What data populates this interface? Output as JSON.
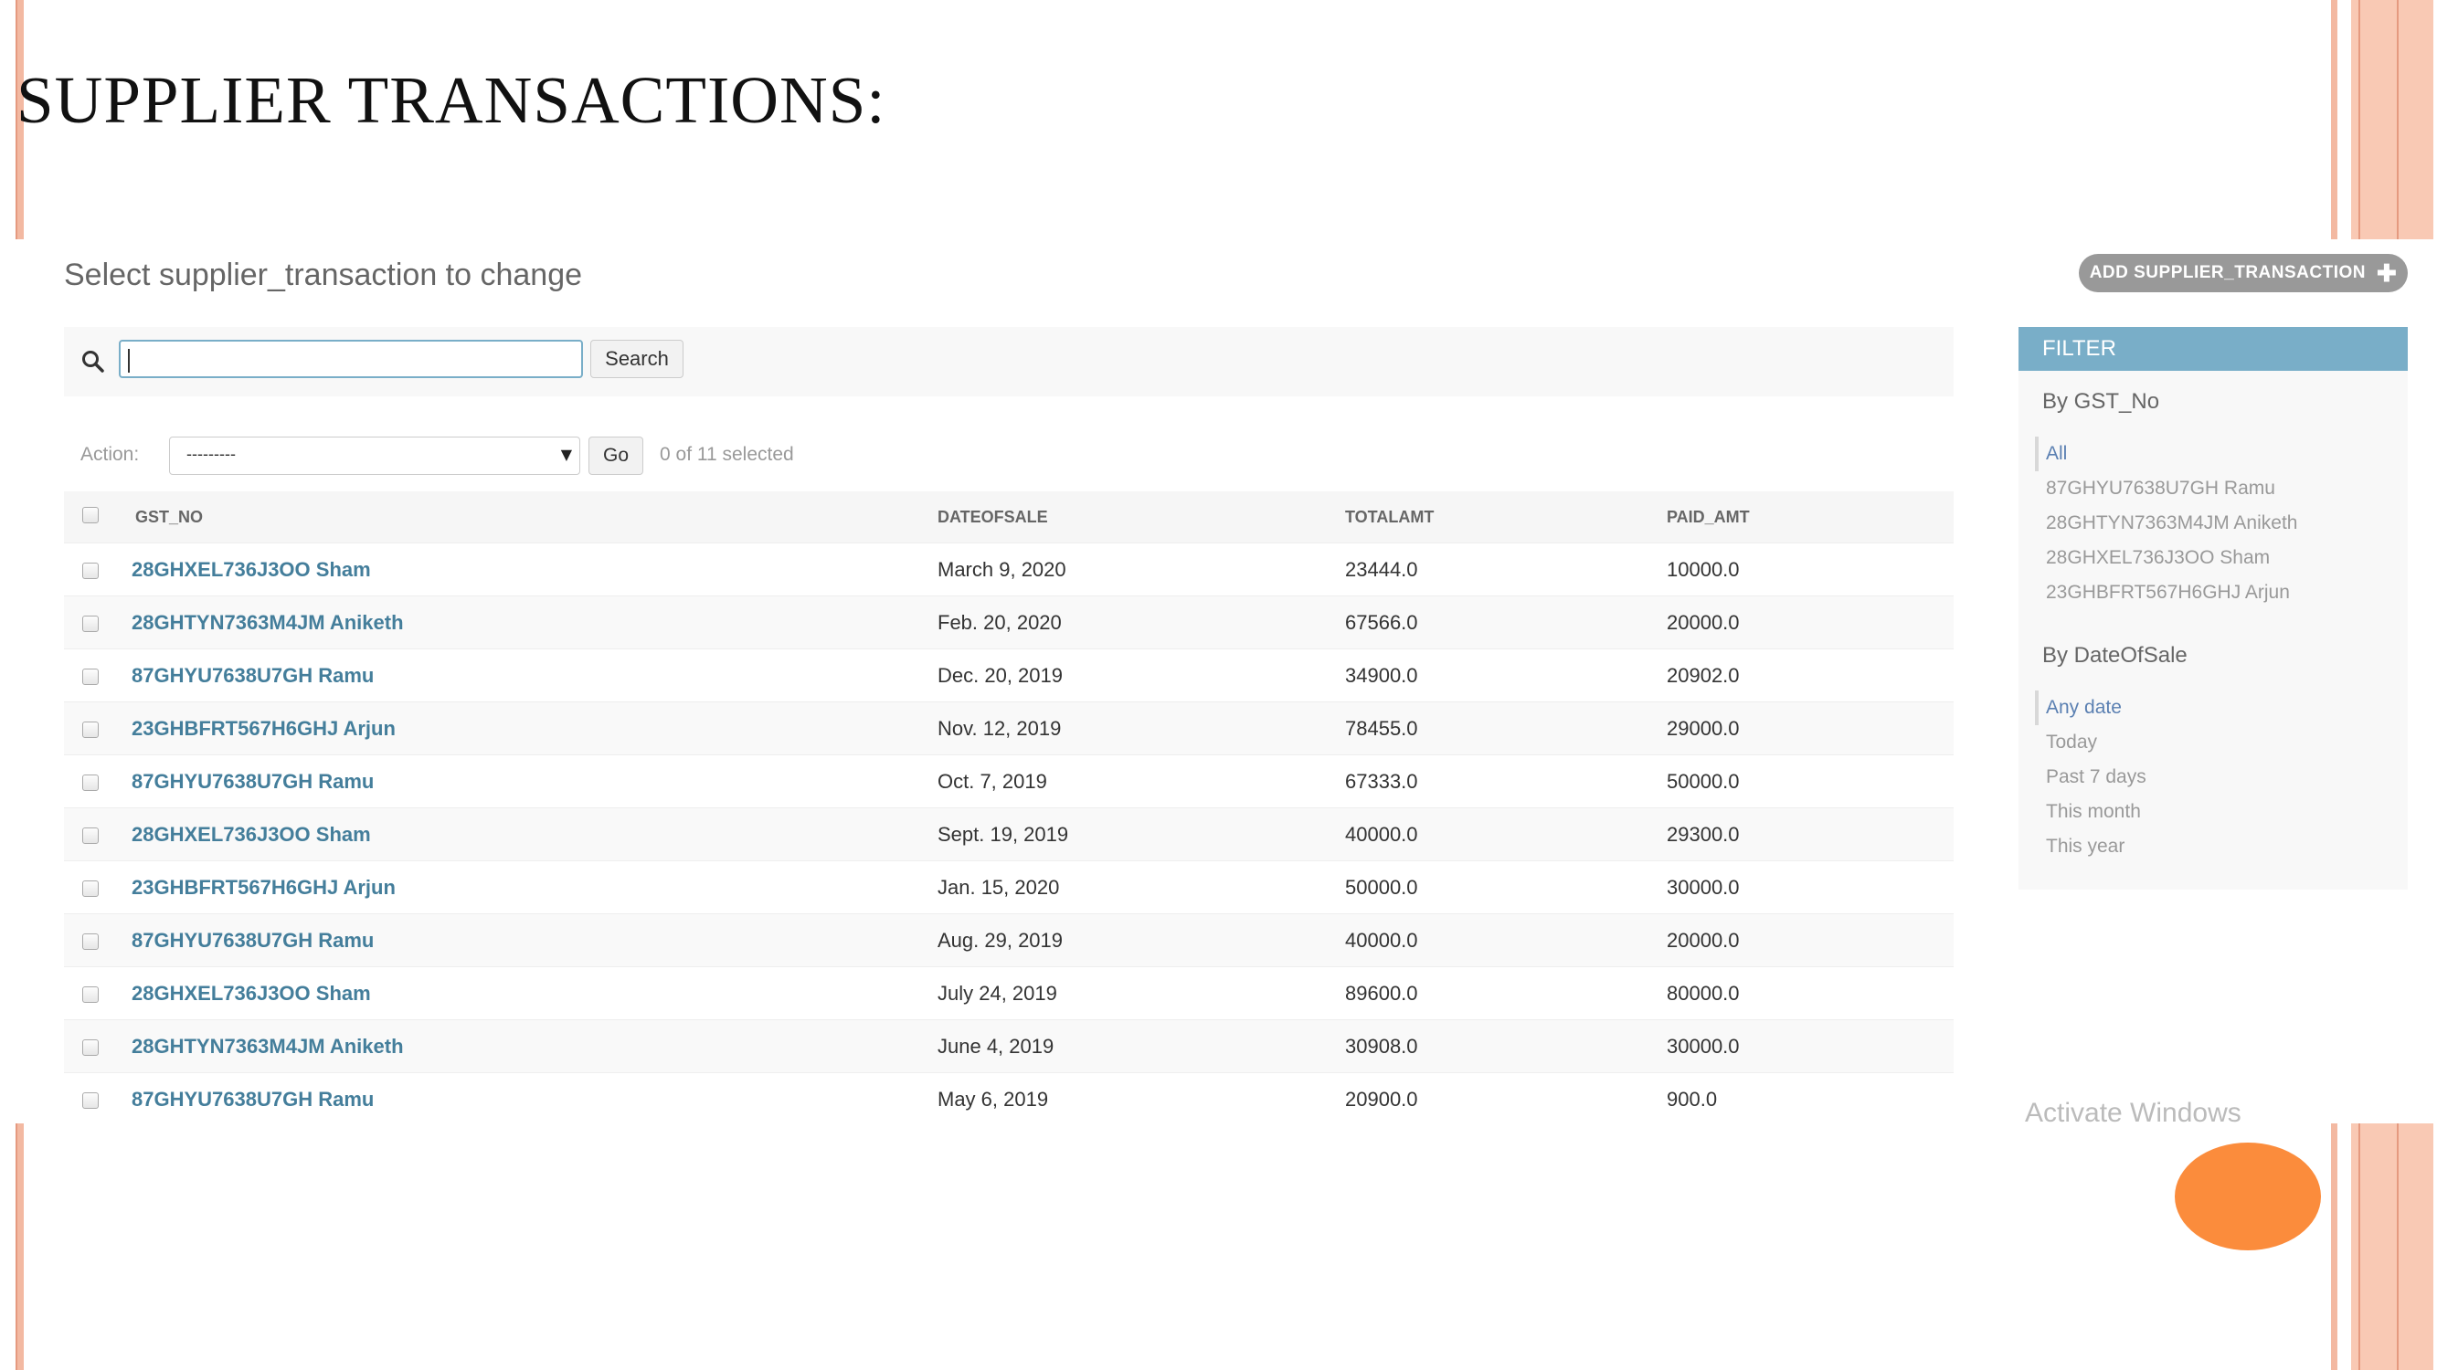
{
  "slide": {
    "title": "SUPPLIER TRANSACTIONS:"
  },
  "admin": {
    "heading": "Select supplier_transaction to change",
    "add_button_label": "ADD SUPPLIER_TRANSACTION",
    "add_button_icon": "plus-icon",
    "search": {
      "value": "",
      "button_label": "Search"
    },
    "actions": {
      "label": "Action:",
      "select_value": "---------",
      "go_label": "Go",
      "selected_text": "0 of 11 selected"
    },
    "table": {
      "headers": [
        "GST_NO",
        "DATEOFSALE",
        "TOTALAMT",
        "PAID_AMT"
      ],
      "rows": [
        {
          "gst_no": "28GHXEL736J3OO Sham",
          "date": "March 9, 2020",
          "total": "23444.0",
          "paid": "10000.0"
        },
        {
          "gst_no": "28GHTYN7363M4JM Aniketh",
          "date": "Feb. 20, 2020",
          "total": "67566.0",
          "paid": "20000.0"
        },
        {
          "gst_no": "87GHYU7638U7GH Ramu",
          "date": "Dec. 20, 2019",
          "total": "34900.0",
          "paid": "20902.0"
        },
        {
          "gst_no": "23GHBFRT567H6GHJ Arjun",
          "date": "Nov. 12, 2019",
          "total": "78455.0",
          "paid": "29000.0"
        },
        {
          "gst_no": "87GHYU7638U7GH Ramu",
          "date": "Oct. 7, 2019",
          "total": "67333.0",
          "paid": "50000.0"
        },
        {
          "gst_no": "28GHXEL736J3OO Sham",
          "date": "Sept. 19, 2019",
          "total": "40000.0",
          "paid": "29300.0"
        },
        {
          "gst_no": "23GHBFRT567H6GHJ Arjun",
          "date": "Jan. 15, 2020",
          "total": "50000.0",
          "paid": "30000.0"
        },
        {
          "gst_no": "87GHYU7638U7GH Ramu",
          "date": "Aug. 29, 2019",
          "total": "40000.0",
          "paid": "20000.0"
        },
        {
          "gst_no": "28GHXEL736J3OO Sham",
          "date": "July 24, 2019",
          "total": "89600.0",
          "paid": "80000.0"
        },
        {
          "gst_no": "28GHTYN7363M4JM Aniketh",
          "date": "June 4, 2019",
          "total": "30908.0",
          "paid": "30000.0"
        },
        {
          "gst_no": "87GHYU7638U7GH Ramu",
          "date": "May 6, 2019",
          "total": "20900.0",
          "paid": "900.0"
        }
      ]
    },
    "filter": {
      "title": "FILTER",
      "by_gst": {
        "heading": "By GST_No",
        "options": [
          "All",
          "87GHYU7638U7GH Ramu",
          "28GHTYN7363M4JM Aniketh",
          "28GHXEL736J3OO Sham",
          "23GHBFRT567H6GHJ Arjun"
        ],
        "selected": "All"
      },
      "by_date": {
        "heading": "By DateOfSale",
        "options": [
          "Any date",
          "Today",
          "Past 7 days",
          "This month",
          "This year"
        ],
        "selected": "Any date"
      }
    },
    "watermark": "Activate Windows"
  },
  "colors": {
    "link": "#447e9b",
    "filter_header": "#79aec8",
    "decoration": "#f3b9a2",
    "circle": "#fb8c3c"
  }
}
